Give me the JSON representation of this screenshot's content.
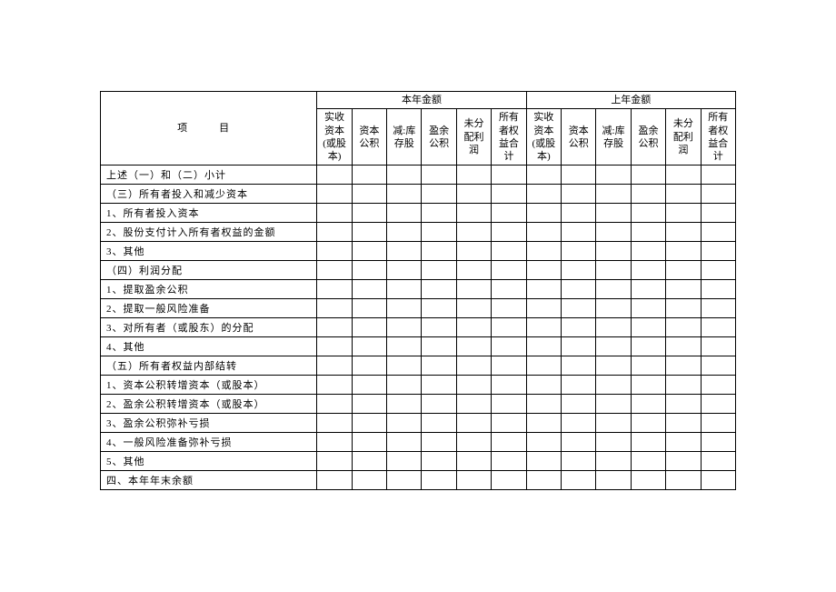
{
  "headers": {
    "item": "项　目",
    "current_year": "本年金额",
    "prior_year": "上年金额",
    "cols": {
      "c1": "实收资本(或股本)",
      "c2": "资本公积",
      "c3": "减:库存股",
      "c4": "盈余公积",
      "c5": "未分配利润",
      "c6": "所有者权益合计"
    }
  },
  "rows": [
    "上述（一）和（二）小计",
    "（三）所有者投入和减少资本",
    "1、所有者投入资本",
    "2、股份支付计入所有者权益的金额",
    "3、其他",
    "（四）利润分配",
    "1、提取盈余公积",
    "2、提取一般风险准备",
    "3、对所有者（或股东）的分配",
    "4、其他",
    "（五）所有者权益内部结转",
    "1、资本公积转增资本（或股本）",
    "2、盈余公积转增资本（或股本）",
    "3、盈余公积弥补亏损",
    "4、一般风险准备弥补亏损",
    "5、其他",
    "四、本年年末余额"
  ]
}
